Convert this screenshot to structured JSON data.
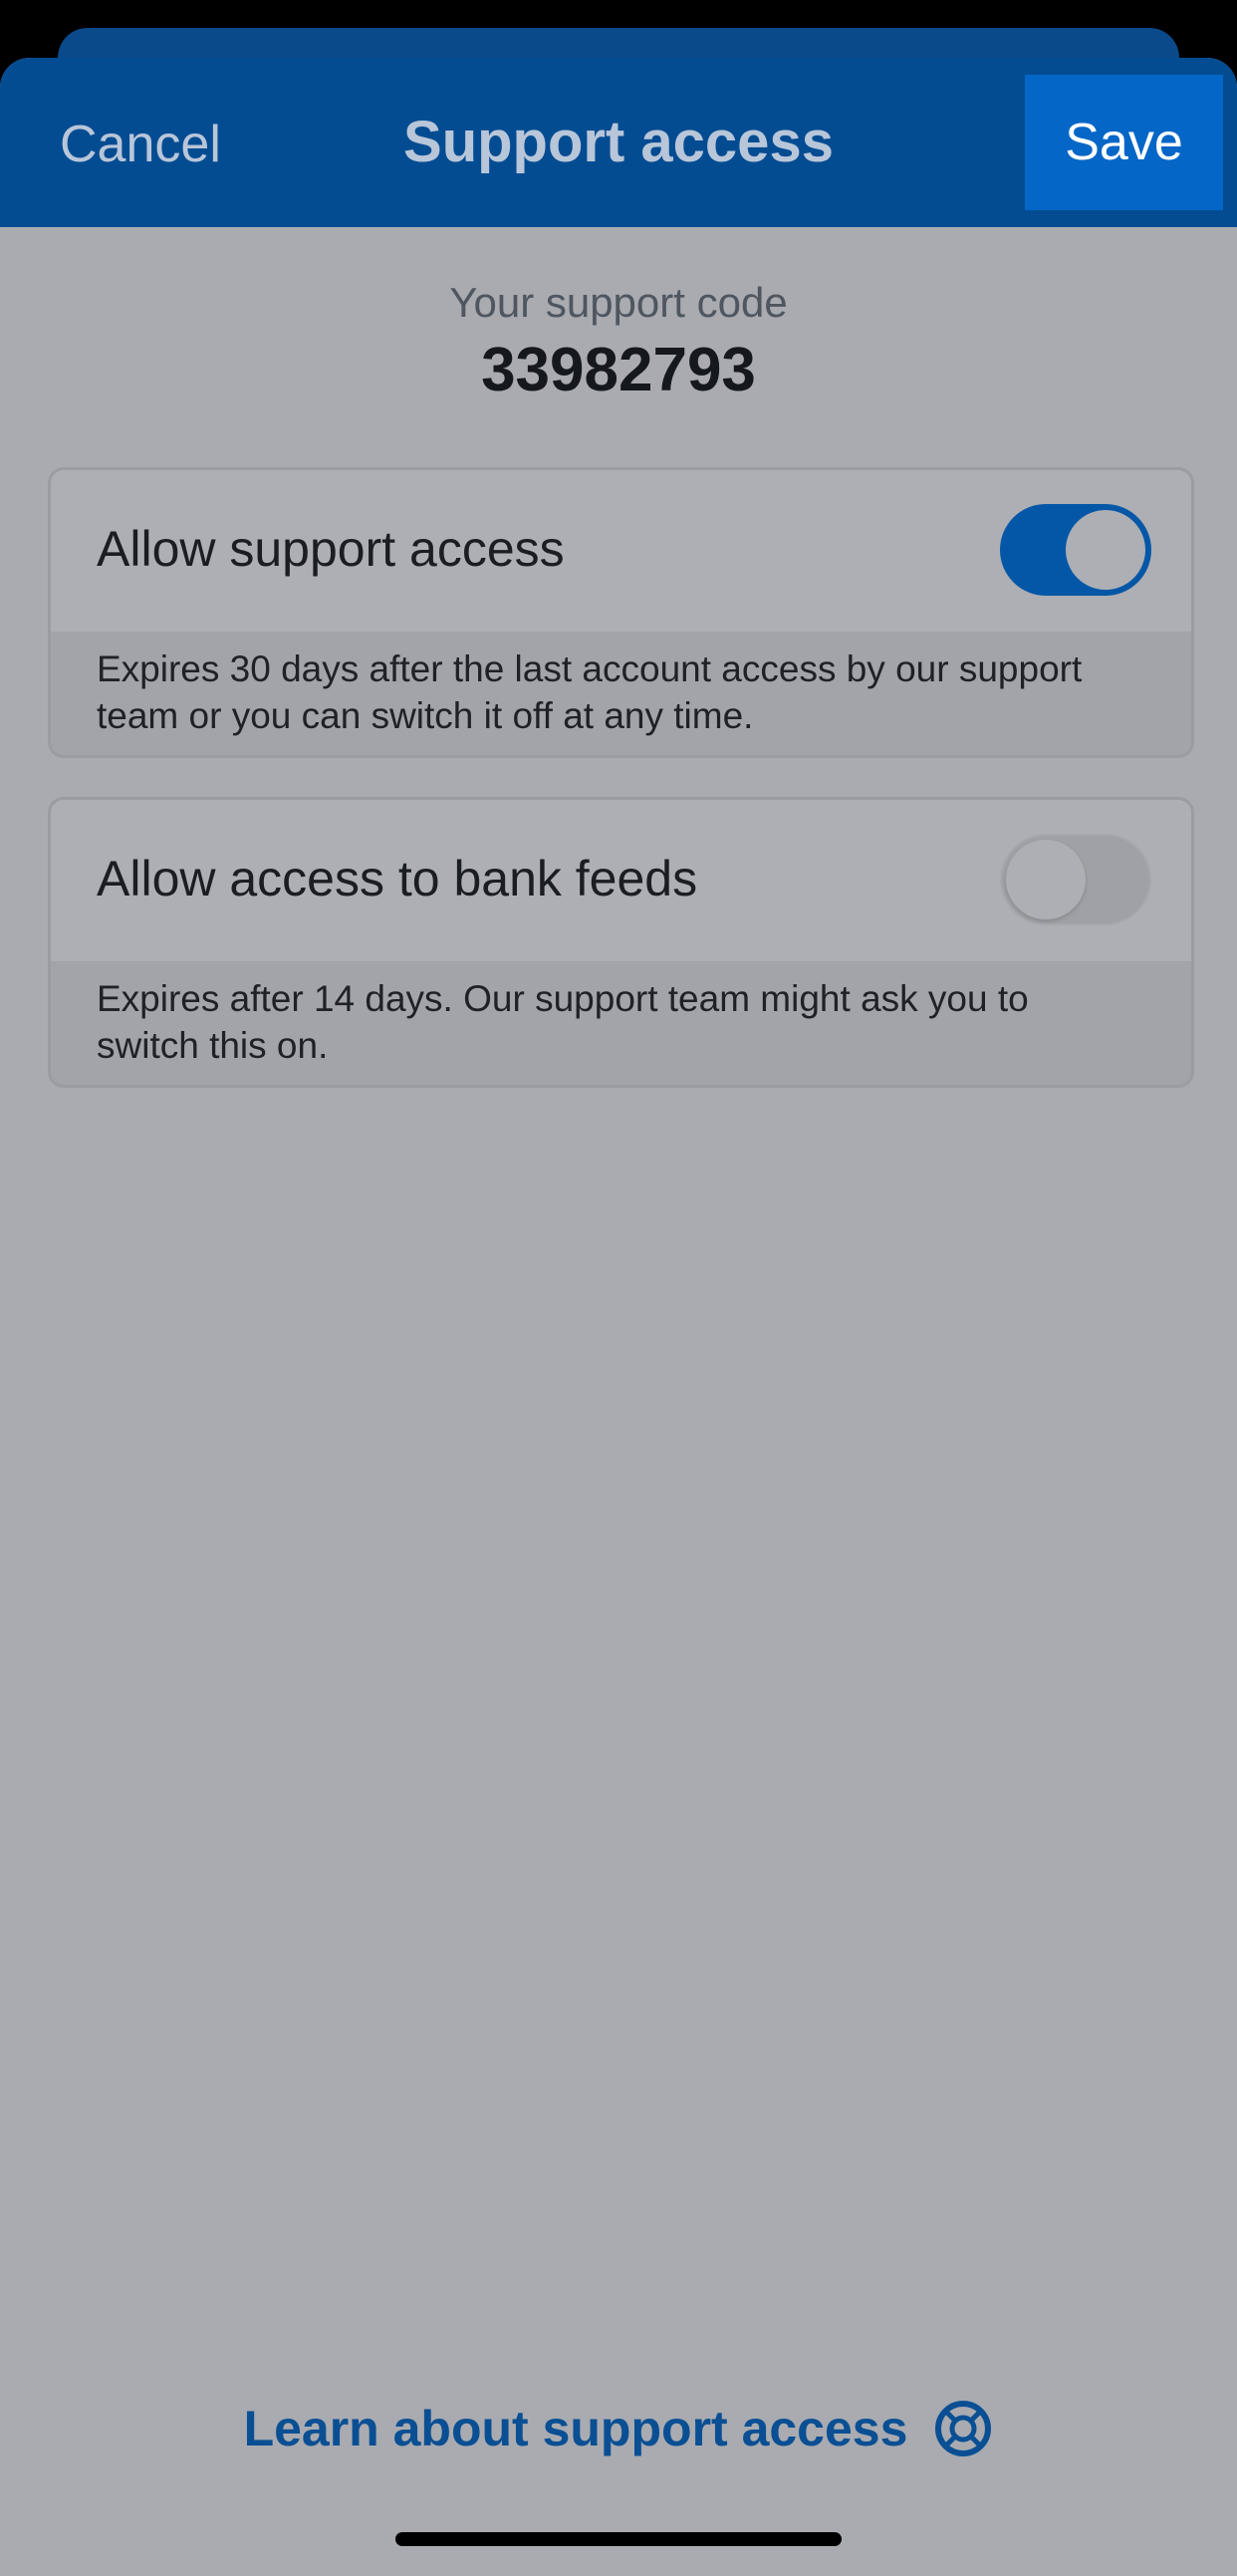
{
  "nav": {
    "cancel_label": "Cancel",
    "title": "Support access",
    "save_label": "Save"
  },
  "support_code": {
    "label": "Your support code",
    "value": "33982793"
  },
  "settings": [
    {
      "label": "Allow support access",
      "enabled": true,
      "description": "Expires 30 days after the last account access by our support team or you can switch it off at any time."
    },
    {
      "label": "Allow access to bank feeds",
      "enabled": false,
      "description": "Expires after 14 days. Our support team might ask you to switch this on."
    }
  ],
  "footer": {
    "learn_link": "Learn about support access",
    "learn_icon": "lifebuoy-icon"
  },
  "colors": {
    "nav_background": "#044c92",
    "save_button": "#0466c7",
    "toggle_on": "#0457a6",
    "link": "#0a4f93",
    "overlay_background": "#a9abb1"
  }
}
